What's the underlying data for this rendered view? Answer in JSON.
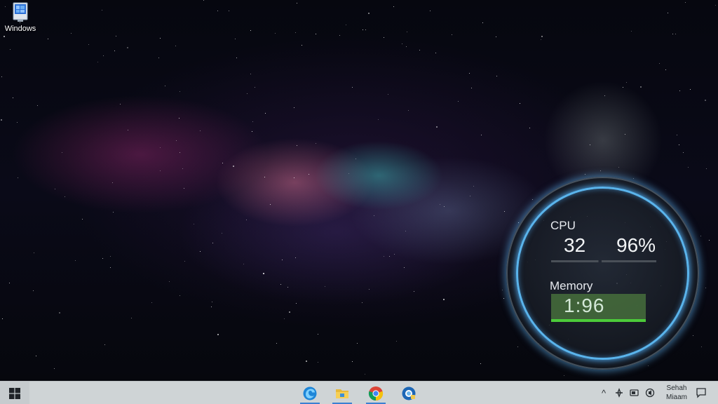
{
  "desktop": {
    "icons": [
      {
        "label": "Windows",
        "icon": "computer-icon"
      }
    ]
  },
  "widget": {
    "cpu_label": "CPU",
    "cpu_value_a": "32",
    "cpu_value_b": "96%",
    "memory_label": "Memory",
    "memory_value": "1:96",
    "accent_color": "#5ab4ec",
    "memory_bar_color": "#4ccb3a"
  },
  "taskbar": {
    "start_icon": "windows-logo-icon",
    "apps": [
      {
        "name": "Microsoft Edge",
        "icon": "edge-icon"
      },
      {
        "name": "File Explorer",
        "icon": "folder-icon"
      },
      {
        "name": "Google Chrome",
        "icon": "chrome-icon"
      },
      {
        "name": "Browser",
        "icon": "browser-icon"
      }
    ],
    "tray": {
      "chevron": "^",
      "clock_line1": "Sehah",
      "clock_line2": "Miaam"
    },
    "background_color": "#cfd4d6"
  }
}
